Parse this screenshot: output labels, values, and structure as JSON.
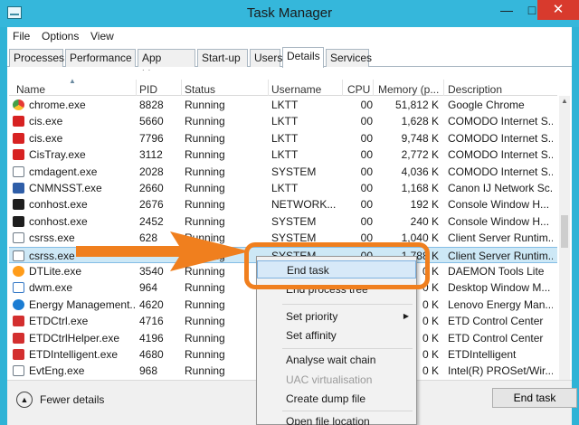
{
  "window": {
    "title": "Task Manager",
    "minimize": "—",
    "maximize": "□",
    "close": "✕"
  },
  "menu": [
    "File",
    "Options",
    "View"
  ],
  "tabs": [
    "Processes",
    "Performance",
    "App history",
    "Start-up",
    "Users",
    "Details",
    "Services"
  ],
  "active_tab": "Details",
  "columns": {
    "name": "Name",
    "pid": "PID",
    "status": "Status",
    "username": "Username",
    "cpu": "CPU",
    "memory": "Memory (p...",
    "description": "Description"
  },
  "rows": [
    {
      "name": "chrome.exe",
      "pid": "8828",
      "status": "Running",
      "user": "LKTT",
      "cpu": "00",
      "mem": "51,812 K",
      "desc": "Google Chrome",
      "icon": "chrome-icon"
    },
    {
      "name": "cis.exe",
      "pid": "5660",
      "status": "Running",
      "user": "LKTT",
      "cpu": "00",
      "mem": "1,628 K",
      "desc": "COMODO Internet S...",
      "icon": "comodo-icon"
    },
    {
      "name": "cis.exe",
      "pid": "7796",
      "status": "Running",
      "user": "LKTT",
      "cpu": "00",
      "mem": "9,748 K",
      "desc": "COMODO Internet S...",
      "icon": "comodo-icon"
    },
    {
      "name": "CisTray.exe",
      "pid": "3112",
      "status": "Running",
      "user": "LKTT",
      "cpu": "00",
      "mem": "2,772 K",
      "desc": "COMODO Internet S...",
      "icon": "comodo-icon"
    },
    {
      "name": "cmdagent.exe",
      "pid": "2028",
      "status": "Running",
      "user": "SYSTEM",
      "cpu": "00",
      "mem": "4,036 K",
      "desc": "COMODO Internet S...",
      "icon": "window-icon"
    },
    {
      "name": "CNMNSST.exe",
      "pid": "2660",
      "status": "Running",
      "user": "LKTT",
      "cpu": "00",
      "mem": "1,168 K",
      "desc": "Canon IJ Network Sc...",
      "icon": "canon-icon"
    },
    {
      "name": "conhost.exe",
      "pid": "2676",
      "status": "Running",
      "user": "NETWORK...",
      "cpu": "00",
      "mem": "192 K",
      "desc": "Console Window H...",
      "icon": "console-icon"
    },
    {
      "name": "conhost.exe",
      "pid": "2452",
      "status": "Running",
      "user": "SYSTEM",
      "cpu": "00",
      "mem": "240 K",
      "desc": "Console Window H...",
      "icon": "console-icon"
    },
    {
      "name": "csrss.exe",
      "pid": "628",
      "status": "Running",
      "user": "SYSTEM",
      "cpu": "00",
      "mem": "1,040 K",
      "desc": "Client Server Runtim...",
      "icon": "window-icon"
    },
    {
      "name": "csrss.exe",
      "pid": "",
      "status": "Running",
      "user": "SYSTEM",
      "cpu": "00",
      "mem": "1,788 K",
      "desc": "Client Server Runtim...",
      "icon": "window-icon",
      "selected": true
    },
    {
      "name": "DTLite.exe",
      "pid": "3540",
      "status": "Running",
      "user": "",
      "cpu": "",
      "mem": "0 K",
      "desc": "DAEMON Tools Lite",
      "icon": "daemon-icon"
    },
    {
      "name": "dwm.exe",
      "pid": "964",
      "status": "Running",
      "user": "",
      "cpu": "",
      "mem": "0 K",
      "desc": "Desktop Window M...",
      "icon": "dwm-icon"
    },
    {
      "name": "Energy Management...",
      "pid": "4620",
      "status": "Running",
      "user": "",
      "cpu": "",
      "mem": "0 K",
      "desc": "Lenovo Energy Man...",
      "icon": "energy-icon"
    },
    {
      "name": "ETDCtrl.exe",
      "pid": "4716",
      "status": "Running",
      "user": "",
      "cpu": "",
      "mem": "0 K",
      "desc": "ETD Control Center",
      "icon": "etd-icon"
    },
    {
      "name": "ETDCtrlHelper.exe",
      "pid": "4196",
      "status": "Running",
      "user": "",
      "cpu": "",
      "mem": "0 K",
      "desc": "ETD Control Center",
      "icon": "etd-icon"
    },
    {
      "name": "ETDIntelligent.exe",
      "pid": "4680",
      "status": "Running",
      "user": "",
      "cpu": "",
      "mem": "0 K",
      "desc": "ETDIntelligent",
      "icon": "etd-icon"
    },
    {
      "name": "EvtEng.exe",
      "pid": "968",
      "status": "Running",
      "user": "",
      "cpu": "",
      "mem": "0 K",
      "desc": "Intel(R) PROSet/Wir...",
      "icon": "window-icon"
    }
  ],
  "context_menu": {
    "end_task": "End task",
    "end_process_tree": "End process tree",
    "set_priority": "Set priority",
    "set_affinity": "Set affinity",
    "analyse_wait_chain": "Analyse wait chain",
    "uac_virtualisation": "UAC virtualisation",
    "create_dump_file": "Create dump file",
    "open_file_location": "Open file location"
  },
  "footer": {
    "fewer_details": "Fewer details",
    "end_task": "End task"
  },
  "colors": {
    "accent": "#35b7db",
    "highlight": "#f07f1e",
    "close": "#d83a2d",
    "selection": "#cde8f6"
  }
}
